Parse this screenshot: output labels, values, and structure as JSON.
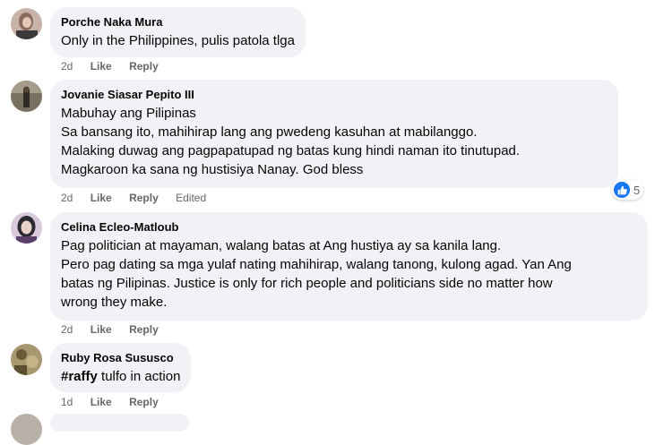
{
  "comments": [
    {
      "author": "Porche Naka Mura",
      "lines": [
        "Only in the Philippines, pulis patola tlga"
      ],
      "time": "2d",
      "like_label": "Like",
      "reply_label": "Reply"
    },
    {
      "author": "Jovanie Siasar Pepito III",
      "lines": [
        "Mabuhay ang Pilipinas",
        "Sa bansang ito, mahihirap lang ang pwedeng kasuhan at mabilanggo.",
        "Malaking duwag ang pagpapatupad ng batas kung hindi naman ito tinutupad.",
        "Magkaroon ka sana ng hustisiya Nanay. God bless"
      ],
      "time": "2d",
      "like_label": "Like",
      "reply_label": "Reply",
      "edited_label": "Edited",
      "reaction_count": "5"
    },
    {
      "author": "Celina Ecleo-Matloub",
      "lines": [
        "Pag politician at mayaman, walang batas at Ang hustiya ay sa kanila lang.",
        "Pero pag dating sa mga yulaf nating mahihirap, walang tanong, kulong agad. Yan Ang",
        "batas ng Pilipinas. Justice is only for rich people and politicians side no matter how",
        "wrong they make."
      ],
      "time": "2d",
      "like_label": "Like",
      "reply_label": "Reply"
    },
    {
      "author": "Ruby Rosa Sususco",
      "hashtag": "#raffy",
      "lines": [
        " tulfo in action"
      ],
      "time": "1d",
      "like_label": "Like",
      "reply_label": "Reply"
    }
  ],
  "colors": {
    "bubble": "#f0f2f5",
    "meta_text": "#65676b",
    "like_blue": "#1877f2"
  },
  "icons": {
    "reaction": "like-thumbs-up-icon"
  }
}
